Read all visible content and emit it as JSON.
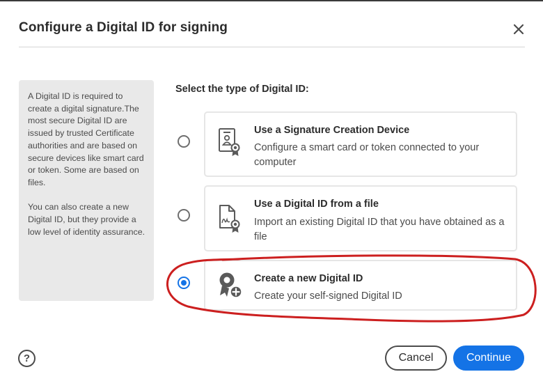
{
  "dialog": {
    "title": "Configure a Digital ID for signing"
  },
  "info_panel": {
    "paragraph1": "A Digital ID is required to create a digital signature.The most secure Digital ID are issued by trusted Certificate authorities and are based on secure devices like smart card or token. Some are based on files.",
    "paragraph2": "You can also create a new Digital ID, but they provide a low level of identity assurance."
  },
  "section": {
    "heading": "Select the type of Digital ID:"
  },
  "options": [
    {
      "title": "Use a Signature Creation Device",
      "description": "Configure a smart card or token connected to your computer",
      "icon": "signature-device-icon",
      "selected": false
    },
    {
      "title": "Use a Digital ID from a file",
      "description": "Import an existing Digital ID that you have obtained as a file",
      "icon": "digital-id-file-icon",
      "selected": false
    },
    {
      "title": "Create a new Digital ID",
      "description": "Create your self-signed Digital ID",
      "icon": "new-digital-id-icon",
      "selected": true
    }
  ],
  "footer": {
    "help_label": "?",
    "cancel_label": "Cancel",
    "continue_label": "Continue"
  },
  "colors": {
    "accent": "#1473e6",
    "annotation": "#cc1f1f",
    "panel_bg": "#e9e9e9"
  }
}
